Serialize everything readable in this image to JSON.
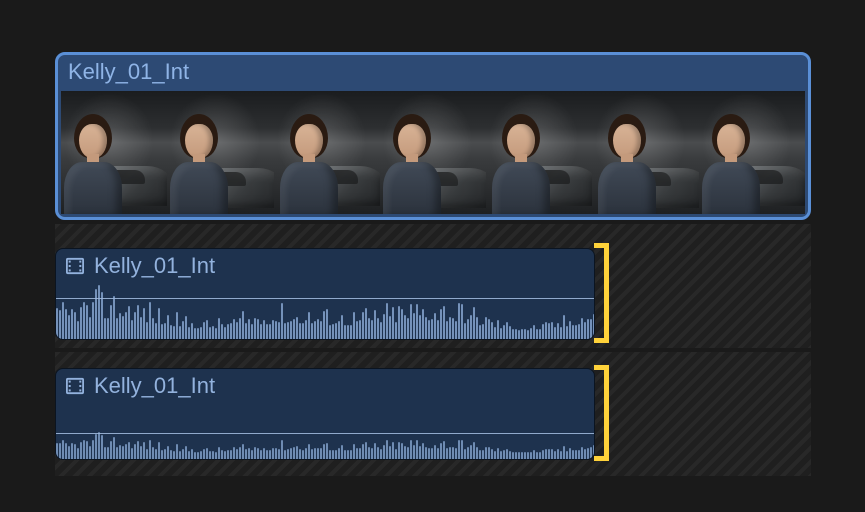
{
  "colors": {
    "bg": "#1a1a1a",
    "clip_fill": "#2d4a74",
    "clip_outline": "#5a8fd6",
    "clip_text": "#8fb4e6",
    "audio_fill": "#1e324e",
    "waveform": "#7e9cc6",
    "bracket": "#ffd23a"
  },
  "timeline": {
    "video_clip": {
      "name": "Kelly_01_Int",
      "selected": true,
      "thumbnail_count": 7
    },
    "audio_clips": [
      {
        "name": "Kelly_01_Int",
        "trim_edge": "right",
        "trim_active": true
      },
      {
        "name": "Kelly_01_Int",
        "trim_edge": "right",
        "trim_active": true
      }
    ]
  }
}
